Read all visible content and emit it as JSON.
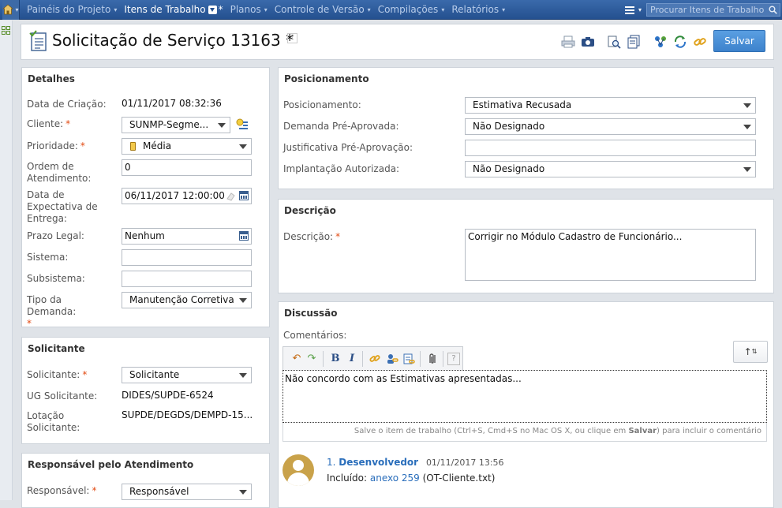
{
  "nav": {
    "items": [
      {
        "label": "Painéis do Projeto"
      },
      {
        "label": "Itens de Trabalho",
        "modified": "*"
      },
      {
        "label": "Planos"
      },
      {
        "label": "Controle de Versão"
      },
      {
        "label": "Compilações"
      },
      {
        "label": "Relatórios"
      }
    ],
    "search_placeholder": "Procurar Itens de Trabalho"
  },
  "header": {
    "title": "Solicitação de Serviço 13163 *",
    "help": "?",
    "save_label": "Salvar"
  },
  "detalhes": {
    "title": "Detalhes",
    "data_criacao_label": "Data de Criação:",
    "data_criacao_value": "01/11/2017 08:32:36",
    "cliente_label": "Cliente:",
    "cliente_value": "SUNMP-Segme...",
    "prioridade_label": "Prioridade:",
    "prioridade_value": "Média",
    "ordem_label": "Ordem de Atendimento:",
    "ordem_value": "0",
    "data_expectativa_label": "Data de Expectativa de Entrega:",
    "data_expectativa_value": "06/11/2017 12:00:00",
    "prazo_label": "Prazo Legal:",
    "prazo_value": "Nenhum",
    "sistema_label": "Sistema:",
    "sistema_value": "",
    "subsistema_label": "Subsistema:",
    "subsistema_value": "",
    "tipo_label": "Tipo da Demanda:",
    "tipo_value": "Manutenção Corretiva",
    "required_mark": "*"
  },
  "solicitante": {
    "title": "Solicitante",
    "solicitante_label": "Solicitante:",
    "solicitante_value": "Solicitante",
    "ug_label": "UG Solicitante:",
    "ug_value": "DIDES/SUPDE-6524",
    "lotacao_label": "Lotação Solicitante:",
    "lotacao_value": "SUPDE/DEGDS/DEMPD-15..."
  },
  "responsavel": {
    "title": "Responsável pelo Atendimento",
    "responsavel_label": "Responsável:",
    "responsavel_value": "Responsável"
  },
  "posicionamento": {
    "title": "Posicionamento",
    "pos_label": "Posicionamento:",
    "pos_value": "Estimativa Recusada",
    "demanda_label": "Demanda Pré-Aprovada:",
    "demanda_value": "Não Designado",
    "justificativa_label": "Justificativa Pré-Aprovação:",
    "justificativa_value": "",
    "implantacao_label": "Implantação Autorizada:",
    "implantacao_value": "Não Designado"
  },
  "descricao": {
    "title": "Descrição",
    "label": "Descrição:",
    "value": "Corrigir no Módulo Cadastro de Funcionário..."
  },
  "discussao": {
    "title": "Discussão",
    "comentarios_label": "Comentários:",
    "editor_text": "Não concordo com as Estimativas apresentadas...",
    "hint_before": "Salve o item de trabalho (Ctrl+S, Cmd+S no Mac OS X, ou clique em ",
    "hint_bold": "Salvar",
    "hint_after": ") para incluir o comentário",
    "comment": {
      "number": "1.",
      "author": "Desenvolvedor",
      "date": "01/11/2017 13:56",
      "text_prefix": "Incluído:",
      "attachment_link": "anexo 259",
      "attachment_name": "(OT-Cliente.txt)"
    }
  },
  "colors": {
    "nav_bg": "#2b5797",
    "save_button": "#4a90d9",
    "required": "#e24b13",
    "link": "#2a6ebb"
  }
}
